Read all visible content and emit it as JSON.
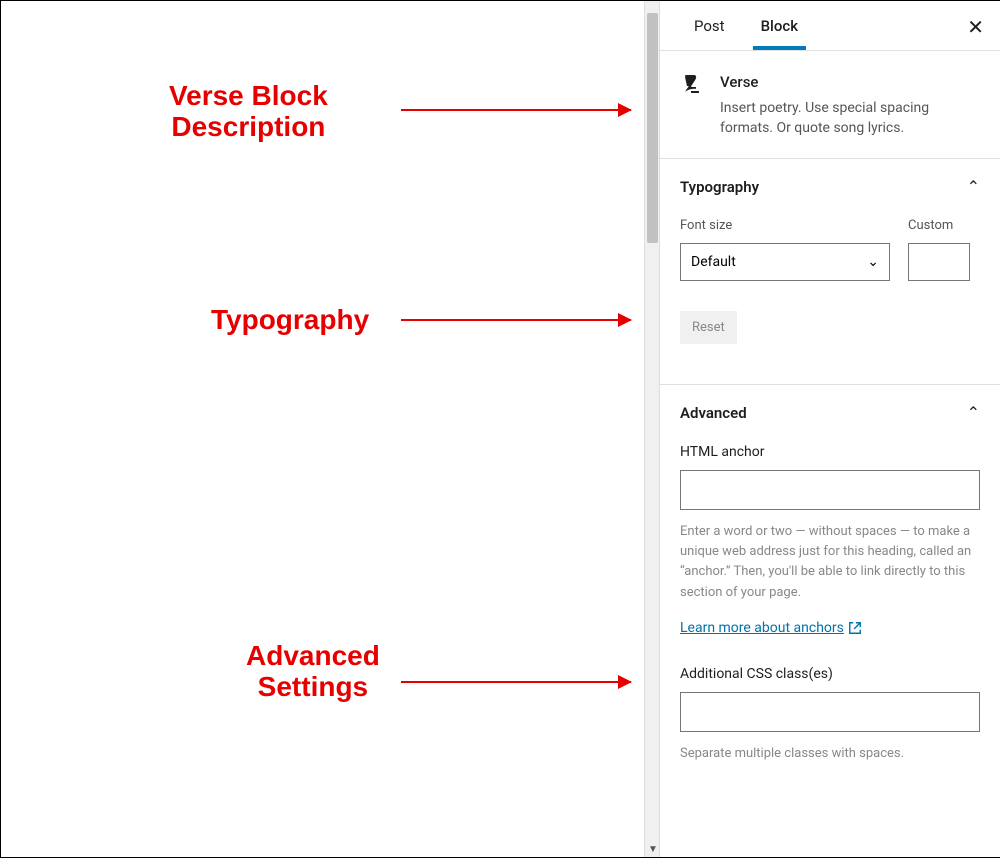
{
  "tabs": {
    "post": "Post",
    "block": "Block"
  },
  "block": {
    "name": "Verse",
    "description": "Insert poetry. Use special spacing formats. Or quote song lyrics."
  },
  "typography": {
    "title": "Typography",
    "font_size_label": "Font size",
    "custom_label": "Custom",
    "font_size_value": "Default",
    "reset": "Reset"
  },
  "advanced": {
    "title": "Advanced",
    "html_anchor_label": "HTML anchor",
    "anchor_help": "Enter a word or two — without spaces — to make a unique web address just for this heading, called an “anchor.” Then, you'll be able to link directly to this section of your page.",
    "learn_more": "Learn more about anchors",
    "css_label": "Additional CSS class(es)",
    "css_help": "Separate multiple classes with spaces."
  },
  "annotations": {
    "verse_desc": "Verse Block\nDescription",
    "typography": "Typography",
    "advanced": "Advanced\nSettings"
  }
}
